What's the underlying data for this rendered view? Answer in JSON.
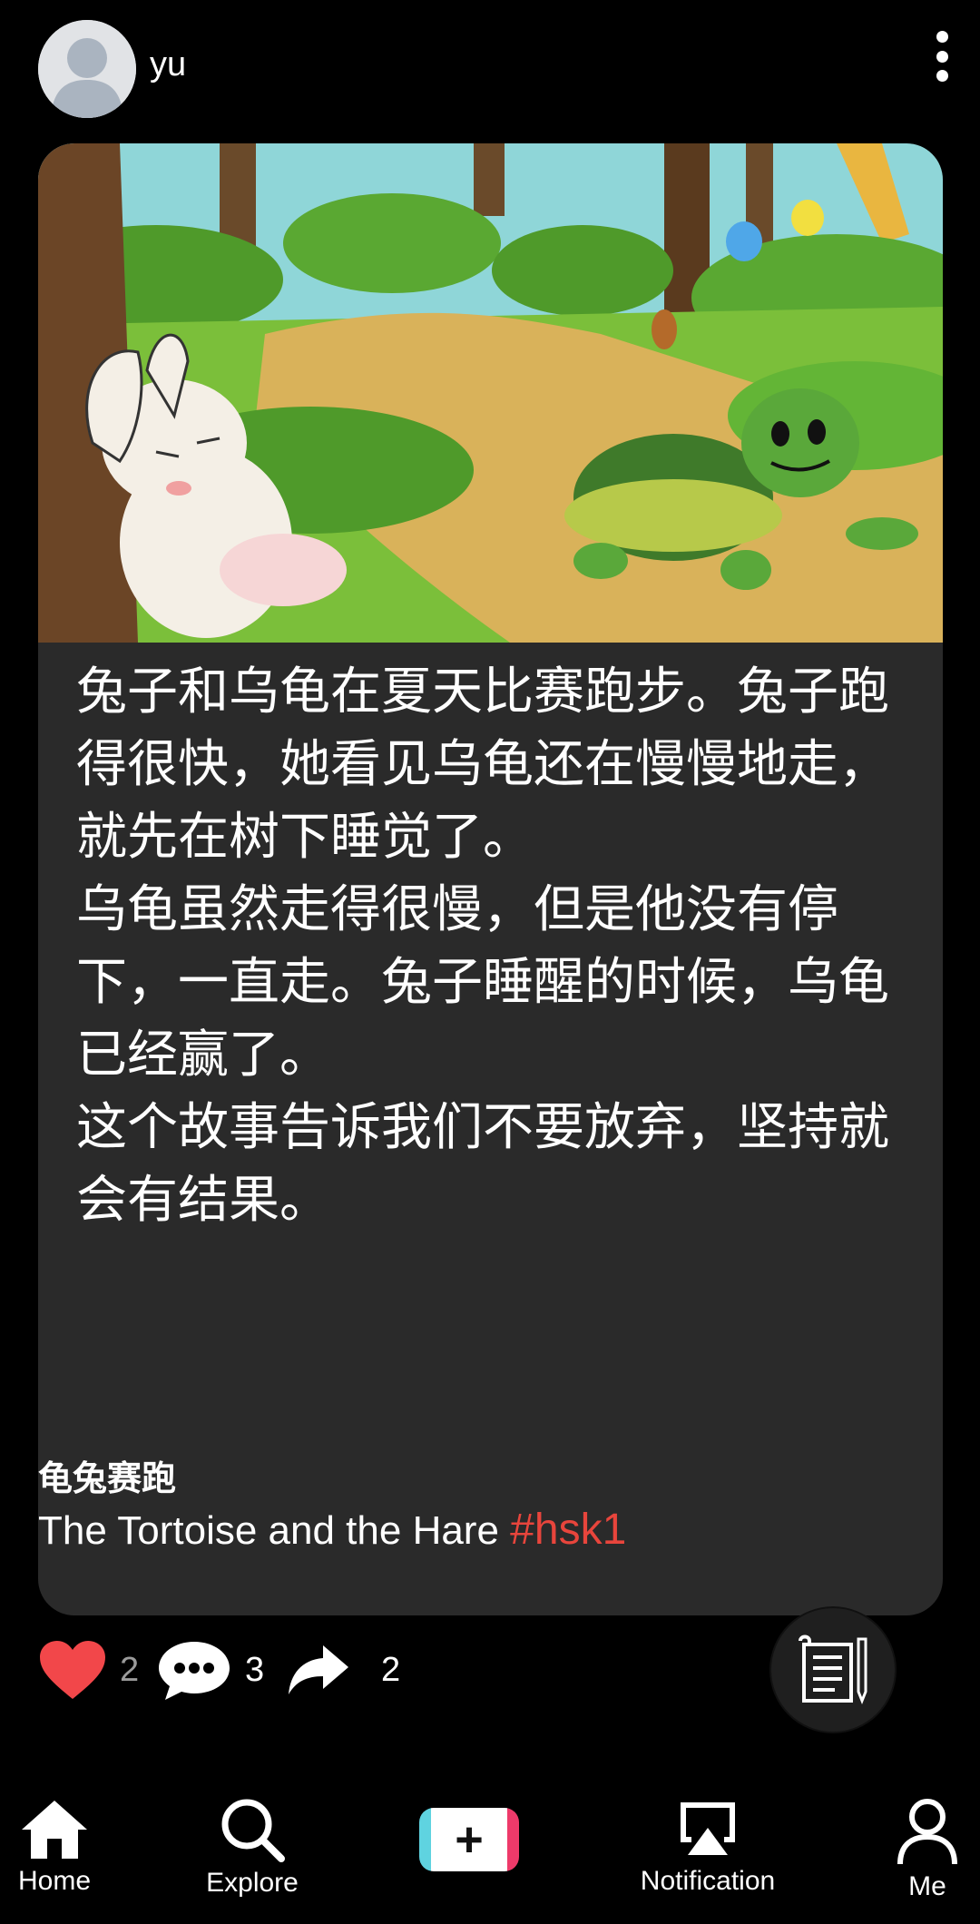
{
  "post": {
    "username": "yu",
    "story_text": "兔子和乌龟在夏天比赛跑步。兔子跑得很快，她看见乌龟还在慢慢地走，就先在树下睡觉了。\n乌龟虽然走得很慢，但是他没有停下，一直走。兔子睡醒的时候，乌龟已经赢了。\n这个故事告诉我们不要放弃，坚持就会有结果。",
    "caption_title": "龟兔赛跑",
    "caption_subtitle": "The Tortoise and the Hare ",
    "hashtag": "#hsk1"
  },
  "actions": {
    "like_count": "2",
    "comment_count": "3",
    "share_count": "2"
  },
  "nav": {
    "home": "Home",
    "explore": "Explore",
    "notification": "Notification",
    "me": "Me"
  },
  "colors": {
    "background": "#000000",
    "card": "#2a2a2a",
    "hashtag": "#e8453c",
    "like": "#f2474a",
    "add_left": "#5fd3e0",
    "add_right": "#ee3a6a"
  },
  "icons": [
    "more-vertical-icon",
    "heart-icon",
    "comment-bubble-icon",
    "share-arrow-icon",
    "notes-pencil-icon",
    "home-icon",
    "search-icon",
    "plus-icon",
    "cast-icon",
    "person-icon"
  ]
}
